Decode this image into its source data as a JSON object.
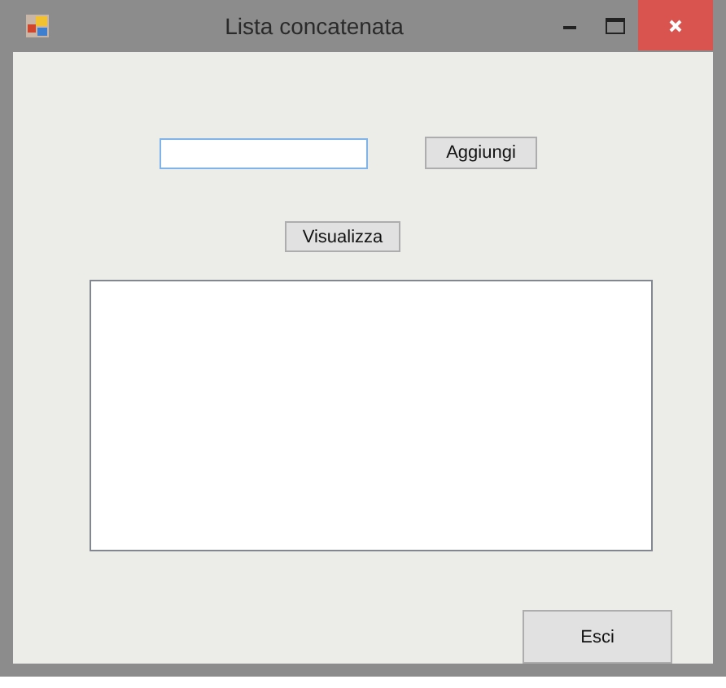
{
  "window": {
    "title": "Lista concatenata"
  },
  "buttons": [
    {
      "label": "Aggiungi"
    },
    {
      "label": "Visualizza"
    },
    {
      "label": "Esci"
    }
  ]
}
